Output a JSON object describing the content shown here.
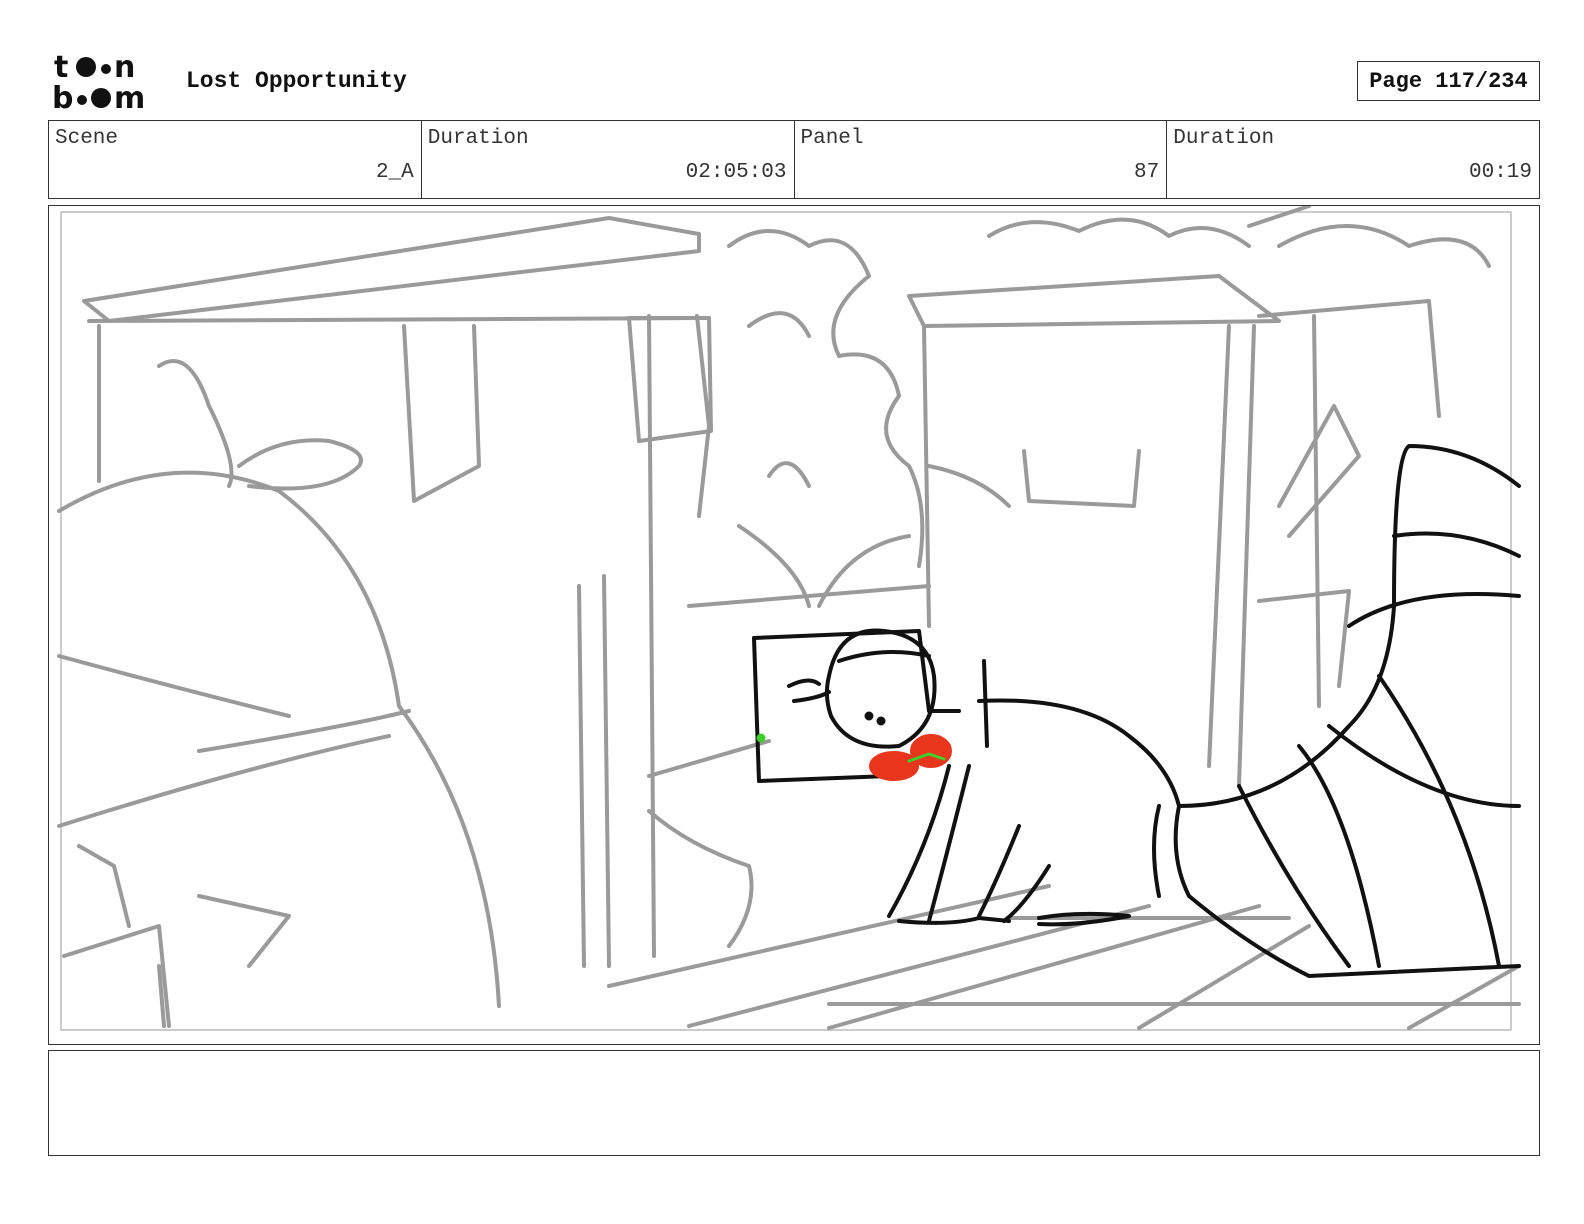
{
  "header": {
    "logo_text": "toon boom",
    "project_title": "Lost Opportunity",
    "page_label": "Page 117/234"
  },
  "info": {
    "scene_label": "Scene",
    "scene_value": "2_A",
    "scene_duration_label": "Duration",
    "scene_duration_value": "02:05:03",
    "panel_label": "Panel",
    "panel_value": "87",
    "panel_duration_label": "Duration",
    "panel_duration_value": "00:19"
  },
  "panel_image": {
    "line_color_rough": "#9a9a9a",
    "line_color_final": "#111111",
    "accent_red": "#e8361c",
    "accent_green": "#3ecf2a"
  },
  "notes": {
    "text": ""
  }
}
